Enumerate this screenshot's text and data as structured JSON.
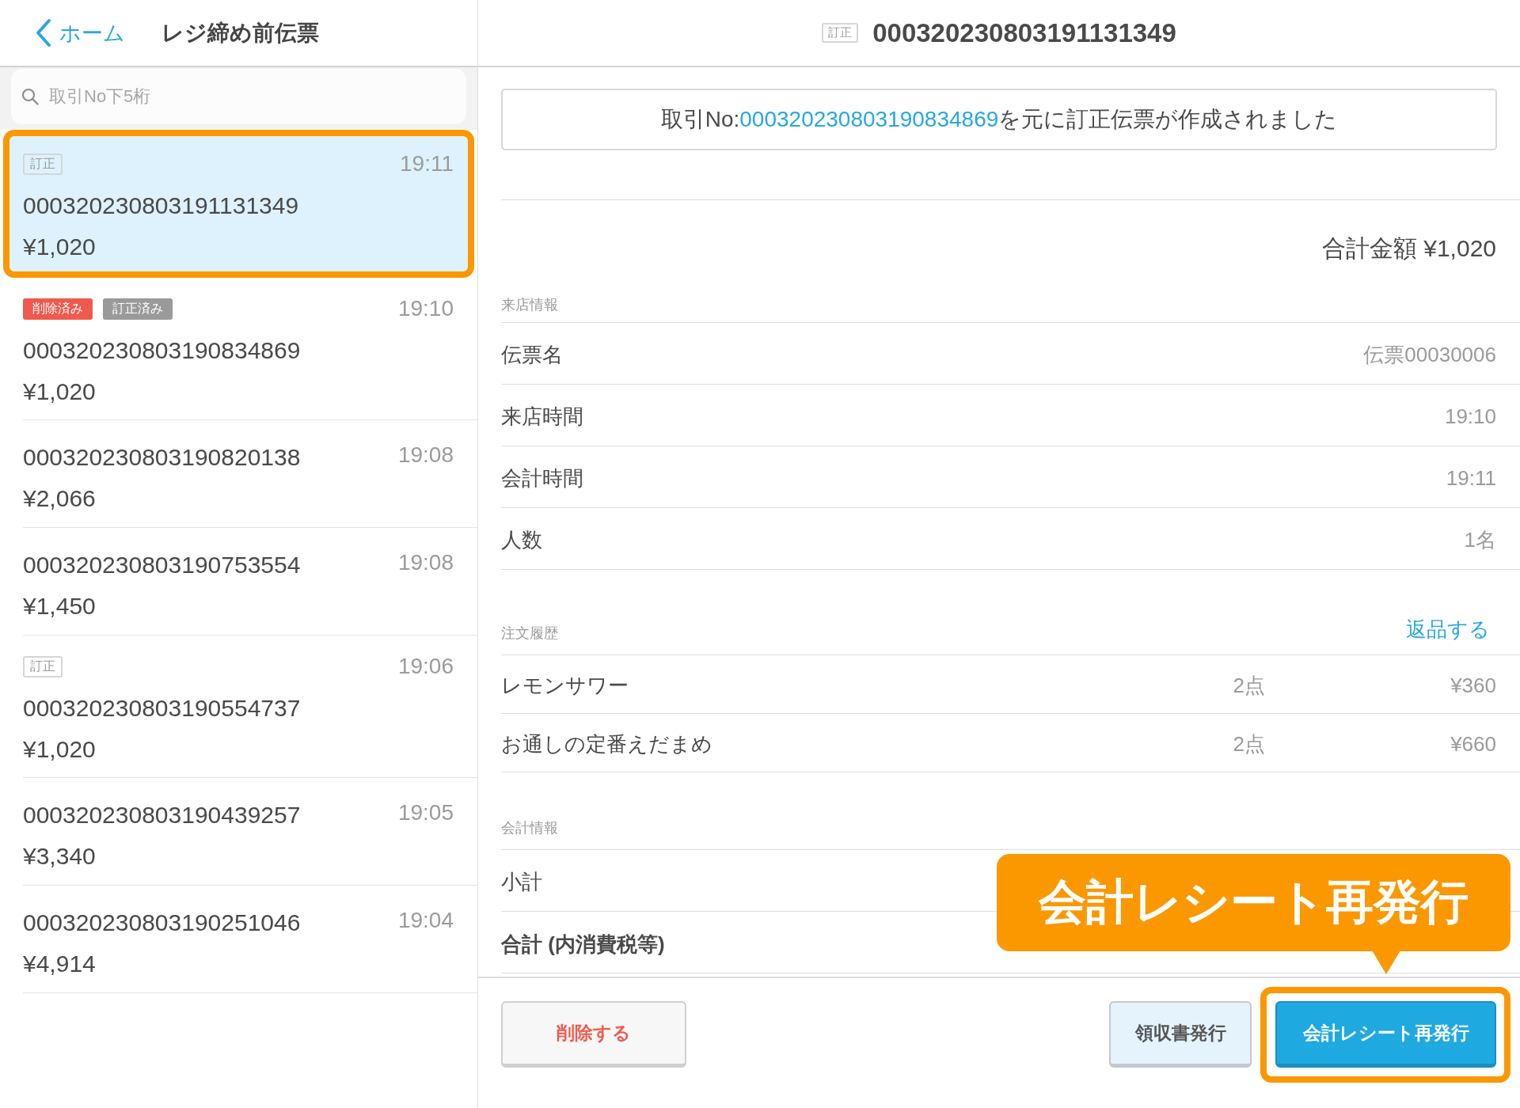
{
  "sidebar": {
    "back_button": {
      "label": "ホーム"
    },
    "title": "レジ締め前伝票",
    "search": {
      "placeholder": "取引No下5桁"
    },
    "transactions": [
      {
        "badges": [
          {
            "label": "訂正",
            "kind": "outline"
          }
        ],
        "time": "19:11",
        "number": "000320230803191131349",
        "amount": "¥1,020",
        "selected": true,
        "highlighted": true
      },
      {
        "badges": [
          {
            "label": "削除済み",
            "kind": "filled",
            "color": "#f05a4e"
          },
          {
            "label": "訂正済み",
            "kind": "filled",
            "color": "#9a9a9a"
          }
        ],
        "time": "19:10",
        "number": "000320230803190834869",
        "amount": "¥1,020",
        "selected": false,
        "highlighted": false
      },
      {
        "time": "19:08",
        "number": "000320230803190820138",
        "amount": "¥2,066",
        "selected": false,
        "highlighted": false
      },
      {
        "time": "19:08",
        "number": "000320230803190753554",
        "amount": "¥1,450",
        "selected": false,
        "highlighted": false
      },
      {
        "badges": [
          {
            "label": "訂正",
            "kind": "outline"
          }
        ],
        "time": "19:06",
        "number": "000320230803190554737",
        "amount": "¥1,020",
        "selected": false,
        "highlighted": false
      },
      {
        "time": "19:05",
        "number": "000320230803190439257",
        "amount": "¥3,340",
        "selected": false,
        "highlighted": false
      },
      {
        "time": "19:04",
        "number": "000320230803190251046",
        "amount": "¥4,914",
        "selected": false,
        "highlighted": false
      }
    ]
  },
  "detail": {
    "header": {
      "badge": {
        "label": "訂正",
        "kind": "outline"
      },
      "number": "000320230803191131349"
    },
    "notice": {
      "prefix": "取引No:",
      "link": "000320230803190834869",
      "suffix": "を元に訂正伝票が作成されました"
    },
    "total": "合計金額 ¥1,020",
    "visit_info": {
      "heading": "来店情報",
      "rows": [
        {
          "label": "伝票名",
          "value": "伝票00030006"
        },
        {
          "label": "来店時間",
          "value": "19:10"
        },
        {
          "label": "会計時間",
          "value": "19:11"
        },
        {
          "label": "人数",
          "value": "1名"
        }
      ]
    },
    "order_history": {
      "heading": "注文履歴",
      "action": "返品する",
      "items": [
        {
          "name": "レモンサワー",
          "quantity": "2点",
          "price": "¥360"
        },
        {
          "name": "お通しの定番えだまめ",
          "quantity": "2点",
          "price": "¥660"
        }
      ]
    },
    "payment_info": {
      "heading": "会計情報",
      "rows": [
        {
          "label": "小計",
          "kind": "plain"
        },
        {
          "label": "合計 (内消費税等)",
          "kind": "total"
        }
      ]
    },
    "buttons": [
      {
        "label": "削除する",
        "kind": "danger",
        "highlighted": false
      },
      {
        "label": "領収書発行",
        "kind": "secondary",
        "highlighted": false
      },
      {
        "label": "会計レシート再発行",
        "kind": "primary",
        "highlighted": true
      }
    ]
  },
  "callout": {
    "text": "会計レシート再発行"
  }
}
